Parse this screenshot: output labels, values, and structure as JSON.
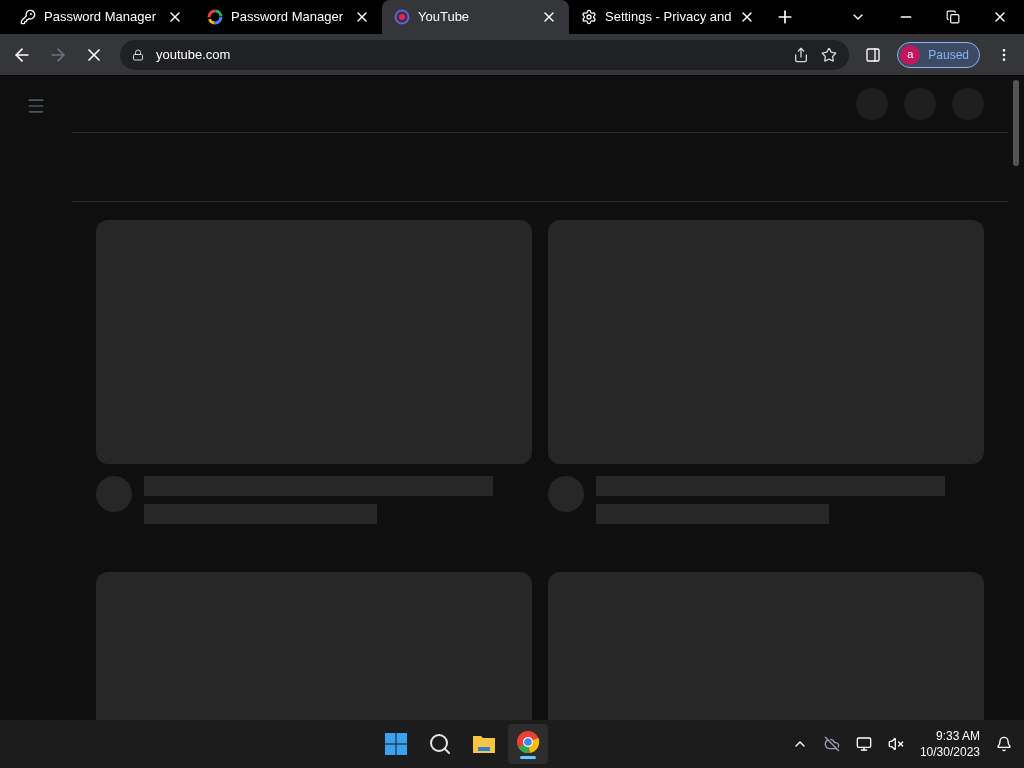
{
  "tabs": [
    {
      "title": "Password Manager",
      "kind": "key",
      "selected": false
    },
    {
      "title": "Password Manager",
      "kind": "google",
      "selected": false
    },
    {
      "title": "YouTube",
      "kind": "youtube",
      "selected": true
    },
    {
      "title": "Settings - Privacy and",
      "kind": "gear",
      "selected": false
    }
  ],
  "address_bar": {
    "url": "youtube.com"
  },
  "profile": {
    "initial": "a",
    "status": "Paused"
  },
  "taskbar": {
    "apps": [
      {
        "kind": "start",
        "selected": false
      },
      {
        "kind": "search",
        "selected": false
      },
      {
        "kind": "folder",
        "selected": false
      },
      {
        "kind": "chrome",
        "selected": true
      }
    ],
    "time": "9:33 AM",
    "date": "10/30/2023"
  }
}
